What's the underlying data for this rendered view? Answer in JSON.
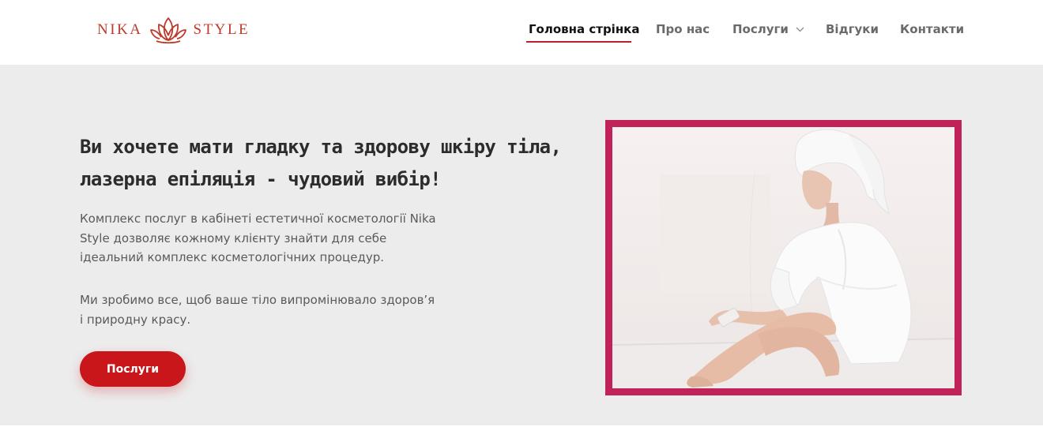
{
  "brand": {
    "name_left": "NIKA",
    "name_right": "STYLE",
    "accent_color": "#c0392b"
  },
  "nav": {
    "items": [
      {
        "label": "Головна стрінка",
        "active": true
      },
      {
        "label": "Про нас",
        "active": false
      },
      {
        "label": "Послуги",
        "active": false,
        "has_dropdown": true
      },
      {
        "label": "Відгуки",
        "active": false
      },
      {
        "label": "Контакти",
        "active": false
      }
    ],
    "active_color": "#b8202a"
  },
  "hero": {
    "headline_lines": [
      "Ви хочете мати гладку та здорову шкіру тіла,",
      "лазерна епіляція - чудовий вибір!"
    ],
    "paragraph1_lines": [
      "Комплекс послуг в кабінеті естетичної косметології Nika",
      "Style дозволяє кожному клієнту знайти для себе",
      "ідеальний комплекс косметологічних процедур."
    ],
    "paragraph2_lines": [
      "Ми зробимо все, щоб ваше тіло випромінювало здоров’я",
      "і природну красу."
    ],
    "cta_label": "Послуги",
    "cta_color": "#c8161b",
    "frame_color": "#c0225a"
  }
}
